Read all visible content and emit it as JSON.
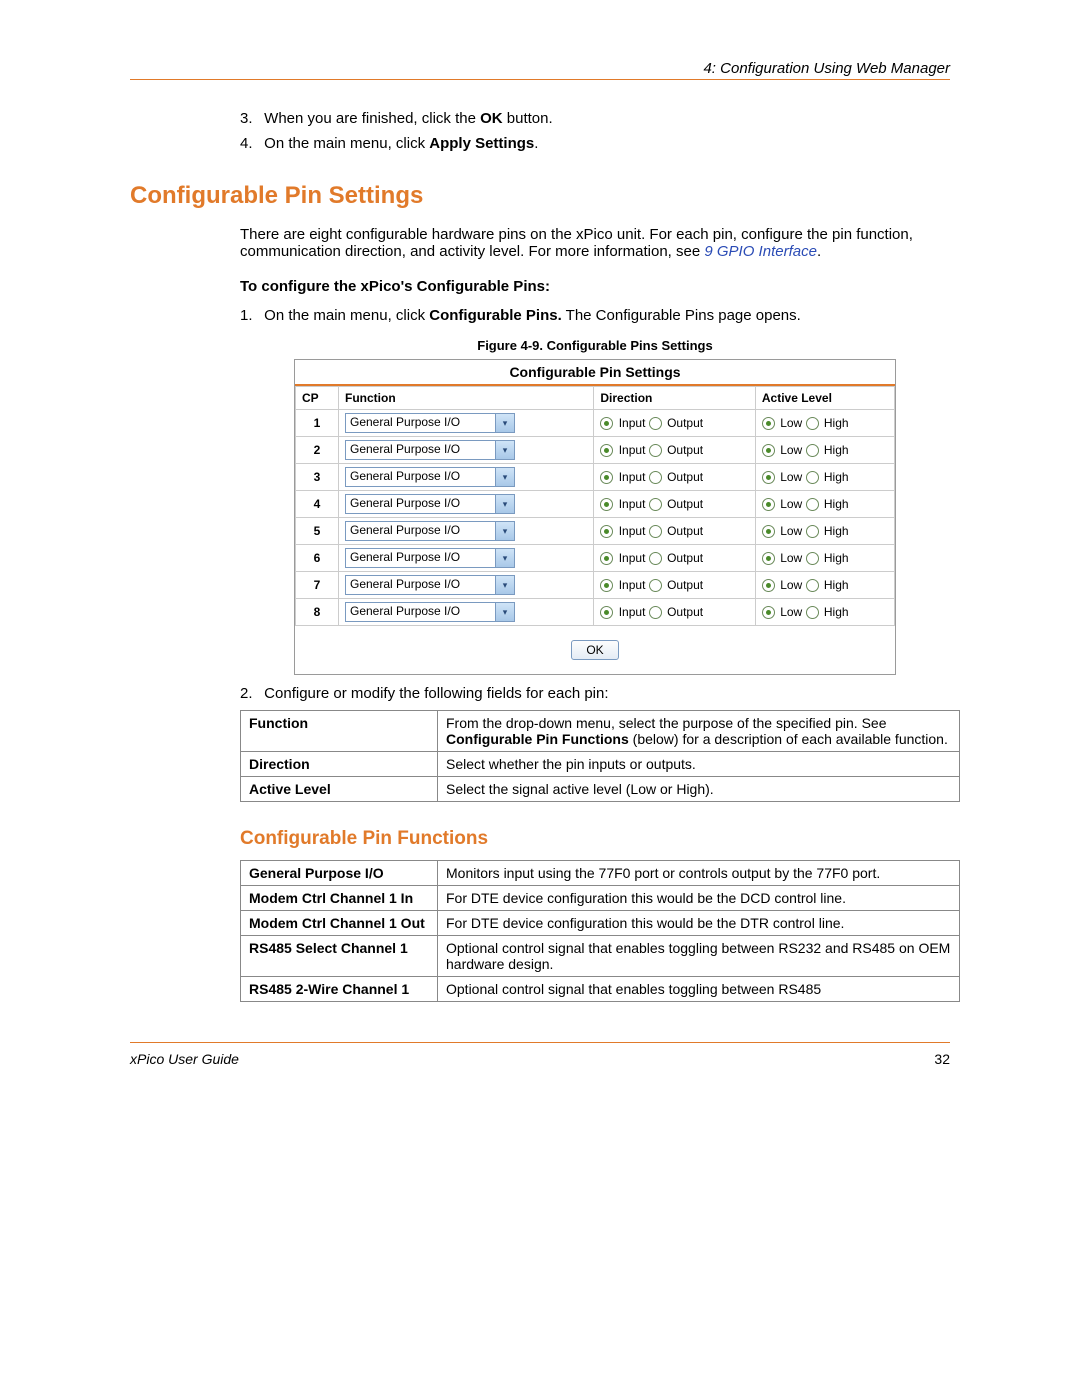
{
  "header": {
    "chapter": "4: Configuration Using Web Manager"
  },
  "topSteps": {
    "s3_num": "3.",
    "s3_a": "When you are finished, click the ",
    "s3_b": "OK",
    "s3_c": " button.",
    "s4_num": "4.",
    "s4_a": "On the main menu, click ",
    "s4_b": "Apply Settings",
    "s4_c": "."
  },
  "h1": "Configurable Pin Settings",
  "intro": {
    "a": "There are eight configurable hardware pins on the xPico unit. For each pin, configure the pin function, communication direction, and activity level. For more information, see ",
    "link": "9 GPIO Interface",
    "b": "."
  },
  "sub1": "To configure the xPico's Configurable Pins:",
  "step1": {
    "num": "1.",
    "a": "On the main menu, click ",
    "b": "Configurable Pins.",
    "c": " The Configurable Pins page opens."
  },
  "figcap": "Figure 4-9. Configurable Pins Settings",
  "panel": {
    "title": "Configurable Pin Settings",
    "headers": {
      "cp": "CP",
      "func": "Function",
      "dir": "Direction",
      "al": "Active Level"
    },
    "funcValue": "General Purpose I/O",
    "dirInput": "Input",
    "dirOutput": "Output",
    "alLow": "Low",
    "alHigh": "High",
    "rows": [
      "1",
      "2",
      "3",
      "4",
      "5",
      "6",
      "7",
      "8"
    ],
    "ok": "OK"
  },
  "step2": {
    "num": "2.",
    "text": "Configure or modify the following fields for each pin:"
  },
  "defTable": {
    "r1k": "Function",
    "r1v_a": "From the drop-down menu, select the purpose of the specified pin. See ",
    "r1v_b": "Configurable Pin Functions",
    "r1v_c": " (below) for a description of each available function.",
    "r2k": "Direction",
    "r2v": "Select whether the pin inputs or outputs.",
    "r3k": "Active Level",
    "r3v": "Select the signal active level (Low or High)."
  },
  "h2": "Configurable Pin Functions",
  "funcTable": {
    "r1k": "General Purpose I/O",
    "r1v": "Monitors input using the 77F0 port or controls output by the 77F0 port.",
    "r2k": "Modem Ctrl Channel 1 In",
    "r2v": "For DTE device configuration this would be the DCD control line.",
    "r3k": "Modem Ctrl Channel 1 Out",
    "r3v": "For DTE device configuration this would be the DTR control line.",
    "r4k": "RS485 Select Channel 1",
    "r4v": "Optional control signal that enables toggling between RS232 and RS485 on OEM hardware design.",
    "r5k": "RS485 2-Wire Channel 1",
    "r5v": "Optional control signal that enables toggling between RS485"
  },
  "footer": {
    "left": "xPico User Guide",
    "page": "32"
  }
}
